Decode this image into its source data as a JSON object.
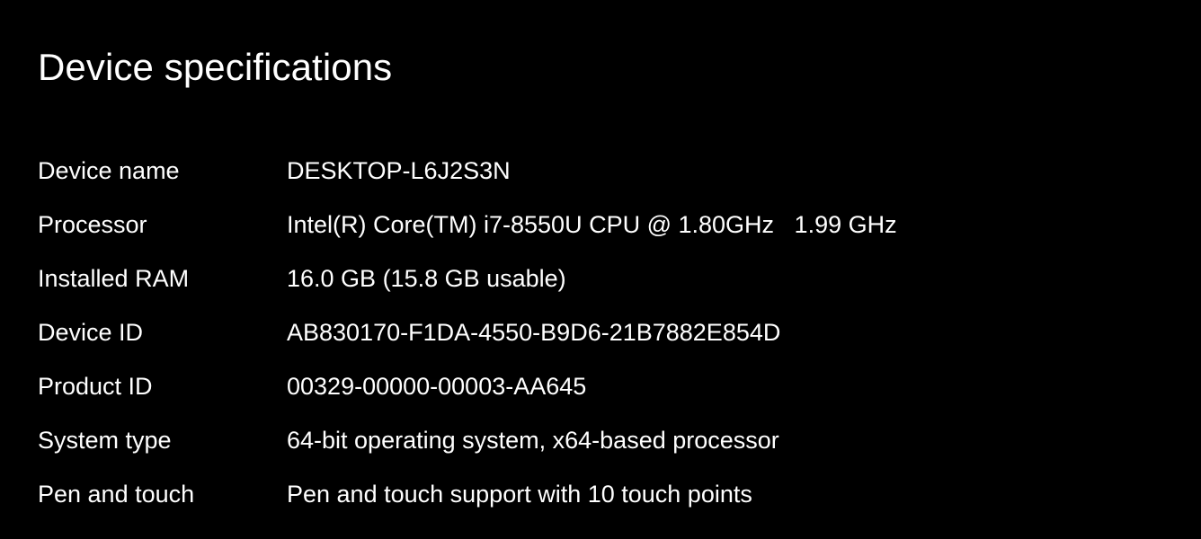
{
  "page": {
    "title": "Device specifications",
    "background_color": "#000000",
    "text_color": "#ffffff"
  },
  "specs": {
    "rows": [
      {
        "label": "Device name",
        "value": "DESKTOP-L6J2S3N"
      },
      {
        "label": "Processor",
        "value": "Intel(R) Core(TM) i7-8550U CPU @ 1.80GHz   1.99 GHz"
      },
      {
        "label": "Installed RAM",
        "value": "16.0 GB (15.8 GB usable)"
      },
      {
        "label": "Device ID",
        "value": "AB830170-F1DA-4550-B9D6-21B7882E854D"
      },
      {
        "label": "Product ID",
        "value": "00329-00000-00003-AA645"
      },
      {
        "label": "System type",
        "value": "64-bit operating system, x64-based processor"
      },
      {
        "label": "Pen and touch",
        "value": "Pen and touch support with 10 touch points"
      }
    ]
  }
}
